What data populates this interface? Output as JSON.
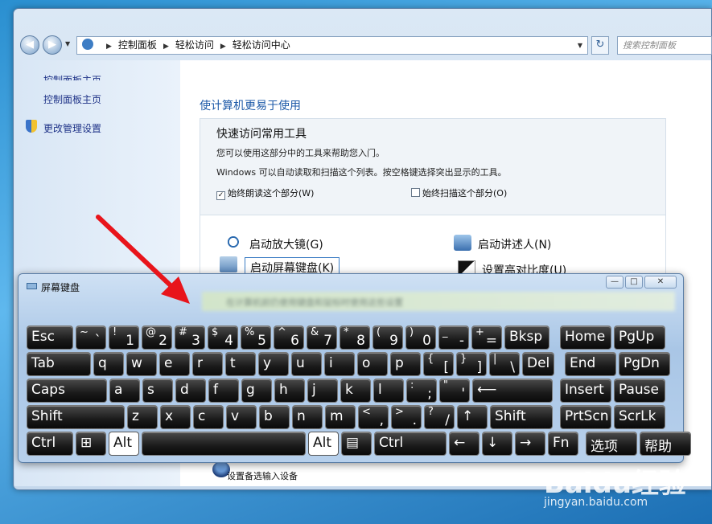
{
  "address": {
    "crumbs": [
      "控制面板",
      "轻松访问",
      "轻松访问中心"
    ],
    "search_placeholder": "搜索控制面板"
  },
  "sidebar": {
    "items": [
      "控制面板主页",
      "控制面板主页",
      "更改管理设置"
    ]
  },
  "main": {
    "title": "使计算机更易于使用",
    "quick_title": "快速访问常用工具",
    "quick_desc1": "您可以使用这部分中的工具来帮助您入门。",
    "quick_desc2": "Windows 可以自动读取和扫描这个列表。按空格键选择突出显示的工具。",
    "check_read": "始终朗读这个部分(W)",
    "check_scan": "始终扫描这个部分(O)",
    "tools": [
      "启动放大镜(G)",
      "启动讲述人(N)",
      "启动屏幕键盘(K)",
      "设置高对比度(U)"
    ],
    "bottom_item": "设置备选输入设备"
  },
  "osk": {
    "title": "屏幕键盘",
    "ctrl_min": "—",
    "ctrl_max": "□",
    "ctrl_close": "✕",
    "blurred_text": "在计算机前仍使用键盘和鼠标时使用这些设置",
    "row1": [
      {
        "l": "Esc"
      },
      {
        "s": "~",
        "b": "`"
      },
      {
        "s": "!",
        "b": "1"
      },
      {
        "s": "@",
        "b": "2"
      },
      {
        "s": "#",
        "b": "3"
      },
      {
        "s": "$",
        "b": "4"
      },
      {
        "s": "%",
        "b": "5"
      },
      {
        "s": "^",
        "b": "6"
      },
      {
        "s": "&",
        "b": "7"
      },
      {
        "s": "*",
        "b": "8"
      },
      {
        "s": "(",
        "b": "9"
      },
      {
        "s": ")",
        "b": "0"
      },
      {
        "s": "_",
        "b": "-"
      },
      {
        "s": "+",
        "b": "="
      },
      {
        "l": "Bksp"
      },
      {
        "l": "Home"
      },
      {
        "l": "PgUp"
      }
    ],
    "row2": [
      {
        "l": "Tab"
      },
      {
        "l": "q"
      },
      {
        "l": "w"
      },
      {
        "l": "e"
      },
      {
        "l": "r"
      },
      {
        "l": "t"
      },
      {
        "l": "y"
      },
      {
        "l": "u"
      },
      {
        "l": "i"
      },
      {
        "l": "o"
      },
      {
        "l": "p"
      },
      {
        "s": "{",
        "b": "["
      },
      {
        "s": "}",
        "b": "]"
      },
      {
        "s": "|",
        "b": "\\"
      },
      {
        "l": "Del"
      },
      {
        "l": "End"
      },
      {
        "l": "PgDn"
      }
    ],
    "row3": [
      {
        "l": "Caps"
      },
      {
        "l": "a"
      },
      {
        "l": "s"
      },
      {
        "l": "d"
      },
      {
        "l": "f"
      },
      {
        "l": "g"
      },
      {
        "l": "h"
      },
      {
        "l": "j"
      },
      {
        "l": "k"
      },
      {
        "l": "l"
      },
      {
        "s": ":",
        "b": ";"
      },
      {
        "s": "\"",
        "b": "'"
      },
      {
        "l": "⟵"
      },
      {
        "l": "Insert"
      },
      {
        "l": "Pause"
      }
    ],
    "row4": [
      {
        "l": "Shift"
      },
      {
        "l": "z"
      },
      {
        "l": "x"
      },
      {
        "l": "c"
      },
      {
        "l": "v"
      },
      {
        "l": "b"
      },
      {
        "l": "n"
      },
      {
        "l": "m"
      },
      {
        "s": "<",
        "b": ","
      },
      {
        "s": ">",
        "b": "."
      },
      {
        "s": "?",
        "b": "/"
      },
      {
        "l": "↑"
      },
      {
        "l": "Shift"
      },
      {
        "l": "PrtScn"
      },
      {
        "l": "ScrLk"
      }
    ],
    "row5": [
      {
        "l": "Ctrl"
      },
      {
        "l": "⊞"
      },
      {
        "l": "Alt"
      },
      {
        "l": ""
      },
      {
        "l": "Alt"
      },
      {
        "l": "▤"
      },
      {
        "l": "Ctrl"
      },
      {
        "l": "←"
      },
      {
        "l": "↓"
      },
      {
        "l": "→"
      },
      {
        "l": "Fn"
      },
      {
        "l": "选项"
      },
      {
        "l": "帮助"
      }
    ]
  },
  "watermark": {
    "brand": "Baidu经验",
    "url": "jingyan.baidu.com"
  }
}
